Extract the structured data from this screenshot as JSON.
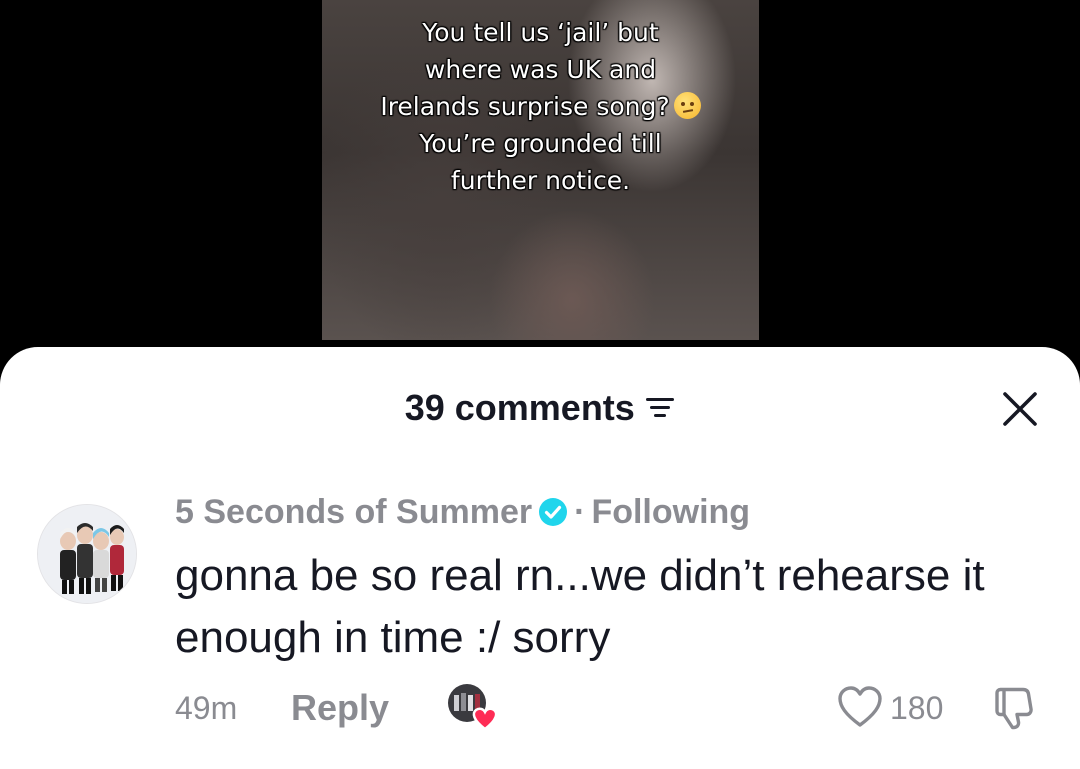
{
  "video": {
    "caption_lines": [
      "You tell us ‘jail’ but",
      "where was UK and",
      "Irelands surprise song?",
      "You’re grounded till",
      "further notice."
    ],
    "caption_emoji": "raised-eyebrow-face-emoji"
  },
  "comments_panel": {
    "count_label": "39 comments",
    "sort_icon": "sort-filter-icon",
    "close_icon": "close-icon"
  },
  "comment": {
    "author": "5 Seconds of Summer",
    "verified": true,
    "separator": "·",
    "relationship": "Following",
    "text": "gonna be so real rn...we didn’t rehearse it enough in time :/ sorry",
    "time": "49m",
    "reply_label": "Reply",
    "liked_by_creator": true,
    "like_count": "180",
    "colors": {
      "verified": "#20d5ec",
      "liked_heart": "#fe2c55",
      "meta_gray": "#8a8b91",
      "text": "#161823"
    }
  }
}
